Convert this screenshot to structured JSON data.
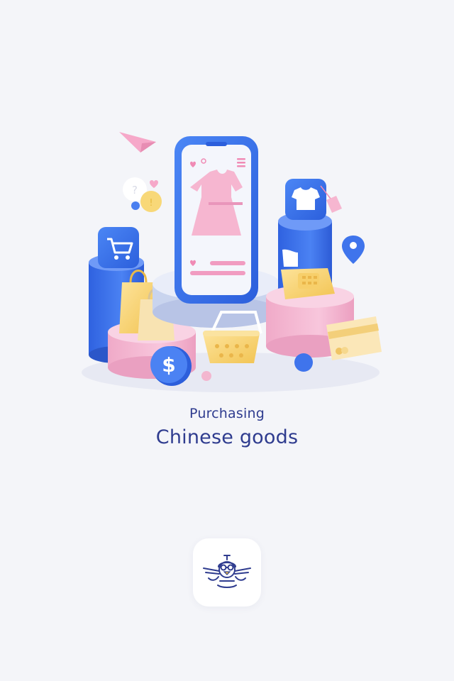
{
  "onboarding": {
    "illustration_icon": "shopping-illustration",
    "caption_line1": "Purchasing",
    "caption_line2": "Chinese goods"
  },
  "brand": {
    "logo_icon": "duck-pilot-logo",
    "color": "#2f3c8f"
  },
  "colors": {
    "background": "#f4f5f9",
    "accent_blue": "#3b6fe8",
    "accent_pink": "#f3b3cf",
    "accent_yellow": "#f7d46a"
  }
}
